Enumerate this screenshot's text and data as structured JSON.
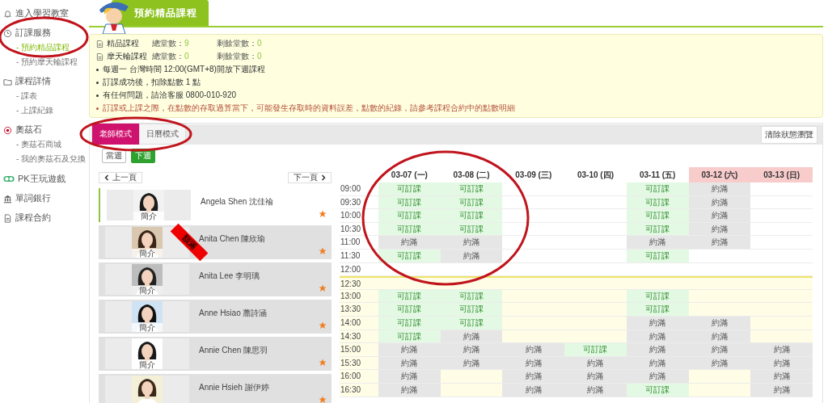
{
  "sidebar": {
    "items": [
      {
        "label": "進入學習教室"
      },
      {
        "label": "訂課服務",
        "children": [
          {
            "label": "- 預約精品課程",
            "selected": true
          },
          {
            "label": "- 預約摩天輪課程",
            "selected": false
          }
        ]
      },
      {
        "label": "課程詳情",
        "children": [
          {
            "label": "- 課表",
            "selected": false
          },
          {
            "label": "- 上課紀錄",
            "selected": false
          }
        ]
      },
      {
        "label": "奧茲石",
        "children": [
          {
            "label": "- 奧茲石商城",
            "selected": false
          },
          {
            "label": "- 我的奧茲石及兌換",
            "selected": false
          }
        ]
      },
      {
        "label": "PK王玩遊戲"
      },
      {
        "label": "單詞銀行"
      },
      {
        "label": "課程合約"
      }
    ]
  },
  "page_title": "預約精品課程",
  "summary": [
    {
      "name": "精品課程",
      "total_label": "總堂數：",
      "total": "9",
      "remain_label": "剩餘堂數：",
      "remain": "0"
    },
    {
      "name": "摩天輪課程",
      "total_label": "總堂數：",
      "total": "0",
      "remain_label": "剩餘堂數：",
      "remain": "0"
    }
  ],
  "notes": [
    {
      "kind": "normal",
      "text": "每週一 台灣時間 12:00(GMT+8)開放下週課程"
    },
    {
      "kind": "normal",
      "text": "訂課成功後，扣除點數 1 點"
    },
    {
      "kind": "normal",
      "text": "有任何問題，請洽客服 0800-010-920"
    },
    {
      "kind": "warning",
      "text": "訂課或上課之際，在點數的存取過算當下，可能發生存取時的資料誤差，點數的紀錄，請參考課程合約中的點數明細"
    }
  ],
  "tabs": [
    {
      "label": "老師模式",
      "selected": true
    },
    {
      "label": "日曆模式",
      "selected": false
    }
  ],
  "clear_button": "清除狀態瀏覽",
  "weeks": [
    {
      "label": "當週",
      "selected": false
    },
    {
      "label": "下週",
      "selected": true
    }
  ],
  "pager": {
    "prev": "上一頁",
    "next": "下一頁"
  },
  "teachers": [
    {
      "name": "Angela Shen 沈佳褕",
      "intro": "簡介",
      "selected": true
    },
    {
      "name": "Anita Chen 陳欣瑜",
      "intro": "簡介",
      "selected": false,
      "ribbon": "額滿"
    },
    {
      "name": "Anita Lee 李明璃",
      "intro": "簡介",
      "selected": false
    },
    {
      "name": "Anne Hsiao 蕭詩涵",
      "intro": "簡介",
      "selected": false
    },
    {
      "name": "Annie Chen 陳思羽",
      "intro": "簡介",
      "selected": false
    },
    {
      "name": "Annie Hsieh 謝伊婷",
      "selected": false
    }
  ],
  "schedule": {
    "columns": [
      {
        "label": "03-07 (一)",
        "weekend": false
      },
      {
        "label": "03-08 (二)",
        "weekend": false
      },
      {
        "label": "03-09 (三)",
        "weekend": false
      },
      {
        "label": "03-10 (四)",
        "weekend": false
      },
      {
        "label": "03-11 (五)",
        "weekend": false
      },
      {
        "label": "03-12 (六)",
        "weekend": true
      },
      {
        "label": "03-13 (日)",
        "weekend": true
      }
    ],
    "rows": [
      {
        "time": "09:00",
        "shaded": false,
        "cells": [
          {
            "kind": "open",
            "text": "可訂課"
          },
          {
            "kind": "open",
            "text": "可訂課"
          },
          {
            "kind": "empty"
          },
          {
            "kind": "empty"
          },
          {
            "kind": "open",
            "text": "可訂課"
          },
          {
            "kind": "full",
            "text": "約滿"
          },
          {
            "kind": "empty"
          }
        ]
      },
      {
        "time": "09:30",
        "shaded": false,
        "cells": [
          {
            "kind": "open",
            "text": "可訂課"
          },
          {
            "kind": "open",
            "text": "可訂課"
          },
          {
            "kind": "empty"
          },
          {
            "kind": "empty"
          },
          {
            "kind": "open",
            "text": "可訂課"
          },
          {
            "kind": "full",
            "text": "約滿"
          },
          {
            "kind": "empty"
          }
        ]
      },
      {
        "time": "10:00",
        "shaded": false,
        "cells": [
          {
            "kind": "open",
            "text": "可訂課"
          },
          {
            "kind": "open",
            "text": "可訂課"
          },
          {
            "kind": "empty"
          },
          {
            "kind": "empty"
          },
          {
            "kind": "open",
            "text": "可訂課"
          },
          {
            "kind": "full",
            "text": "約滿"
          },
          {
            "kind": "empty"
          }
        ]
      },
      {
        "time": "10:30",
        "shaded": false,
        "cells": [
          {
            "kind": "open",
            "text": "可訂課"
          },
          {
            "kind": "open",
            "text": "可訂課"
          },
          {
            "kind": "empty"
          },
          {
            "kind": "empty"
          },
          {
            "kind": "open",
            "text": "可訂課"
          },
          {
            "kind": "full",
            "text": "約滿"
          },
          {
            "kind": "empty"
          }
        ]
      },
      {
        "time": "11:00",
        "shaded": false,
        "cells": [
          {
            "kind": "full",
            "text": "約滿"
          },
          {
            "kind": "full",
            "text": "約滿"
          },
          {
            "kind": "empty"
          },
          {
            "kind": "empty"
          },
          {
            "kind": "full",
            "text": "約滿"
          },
          {
            "kind": "full",
            "text": "約滿"
          },
          {
            "kind": "empty"
          }
        ]
      },
      {
        "time": "11:30",
        "shaded": false,
        "cells": [
          {
            "kind": "open",
            "text": "可訂課"
          },
          {
            "kind": "full",
            "text": "約滿"
          },
          {
            "kind": "empty"
          },
          {
            "kind": "empty"
          },
          {
            "kind": "open",
            "text": "可訂課"
          },
          {
            "kind": "empty"
          },
          {
            "kind": "empty"
          }
        ]
      },
      {
        "time": "12:00",
        "shaded": false,
        "cells": [
          {
            "kind": "empty"
          },
          {
            "kind": "empty"
          },
          {
            "kind": "empty"
          },
          {
            "kind": "empty"
          },
          {
            "kind": "empty"
          },
          {
            "kind": "empty"
          },
          {
            "kind": "empty"
          }
        ]
      },
      {
        "time": "12:30",
        "shaded": true,
        "cells": [
          {
            "kind": "empty"
          },
          {
            "kind": "empty"
          },
          {
            "kind": "empty"
          },
          {
            "kind": "empty"
          },
          {
            "kind": "empty"
          },
          {
            "kind": "empty"
          },
          {
            "kind": "empty"
          }
        ]
      },
      {
        "time": "13:00",
        "shaded": true,
        "cells": [
          {
            "kind": "open",
            "text": "可訂課"
          },
          {
            "kind": "open",
            "text": "可訂課"
          },
          {
            "kind": "empty"
          },
          {
            "kind": "empty"
          },
          {
            "kind": "open",
            "text": "可訂課"
          },
          {
            "kind": "empty"
          },
          {
            "kind": "empty"
          }
        ]
      },
      {
        "time": "13:30",
        "shaded": true,
        "cells": [
          {
            "kind": "open",
            "text": "可訂課"
          },
          {
            "kind": "open",
            "text": "可訂課"
          },
          {
            "kind": "empty"
          },
          {
            "kind": "empty"
          },
          {
            "kind": "open",
            "text": "可訂課"
          },
          {
            "kind": "empty"
          },
          {
            "kind": "empty"
          }
        ]
      },
      {
        "time": "14:00",
        "shaded": true,
        "cells": [
          {
            "kind": "open",
            "text": "可訂課"
          },
          {
            "kind": "open",
            "text": "可訂課"
          },
          {
            "kind": "empty"
          },
          {
            "kind": "empty"
          },
          {
            "kind": "full",
            "text": "約滿"
          },
          {
            "kind": "full",
            "text": "約滿"
          },
          {
            "kind": "empty"
          }
        ]
      },
      {
        "time": "14:30",
        "shaded": true,
        "cells": [
          {
            "kind": "open",
            "text": "可訂課"
          },
          {
            "kind": "full",
            "text": "約滿"
          },
          {
            "kind": "empty"
          },
          {
            "kind": "empty"
          },
          {
            "kind": "full",
            "text": "約滿"
          },
          {
            "kind": "full",
            "text": "約滿"
          },
          {
            "kind": "empty"
          }
        ]
      },
      {
        "time": "15:00",
        "shaded": true,
        "cells": [
          {
            "kind": "full",
            "text": "約滿"
          },
          {
            "kind": "full",
            "text": "約滿"
          },
          {
            "kind": "full",
            "text": "約滿"
          },
          {
            "kind": "open",
            "text": "可訂課"
          },
          {
            "kind": "full",
            "text": "約滿"
          },
          {
            "kind": "full",
            "text": "約滿"
          },
          {
            "kind": "full",
            "text": "約滿"
          }
        ]
      },
      {
        "time": "15:30",
        "shaded": true,
        "cells": [
          {
            "kind": "full",
            "text": "約滿"
          },
          {
            "kind": "full",
            "text": "約滿"
          },
          {
            "kind": "full",
            "text": "約滿"
          },
          {
            "kind": "full",
            "text": "約滿"
          },
          {
            "kind": "full",
            "text": "約滿"
          },
          {
            "kind": "full",
            "text": "約滿"
          },
          {
            "kind": "full",
            "text": "約滿"
          }
        ]
      },
      {
        "time": "16:00",
        "shaded": true,
        "cells": [
          {
            "kind": "full",
            "text": "約滿"
          },
          {
            "kind": "empty"
          },
          {
            "kind": "full",
            "text": "約滿"
          },
          {
            "kind": "full",
            "text": "約滿"
          },
          {
            "kind": "full",
            "text": "約滿"
          },
          {
            "kind": "empty"
          },
          {
            "kind": "full",
            "text": "約滿"
          }
        ]
      },
      {
        "time": "16:30",
        "shaded": true,
        "cells": [
          {
            "kind": "full",
            "text": "約滿"
          },
          {
            "kind": "empty"
          },
          {
            "kind": "full",
            "text": "約滿"
          },
          {
            "kind": "full",
            "text": "約滿"
          },
          {
            "kind": "open",
            "text": "可訂課"
          },
          {
            "kind": "empty"
          },
          {
            "kind": "full",
            "text": "約滿"
          }
        ]
      }
    ]
  }
}
